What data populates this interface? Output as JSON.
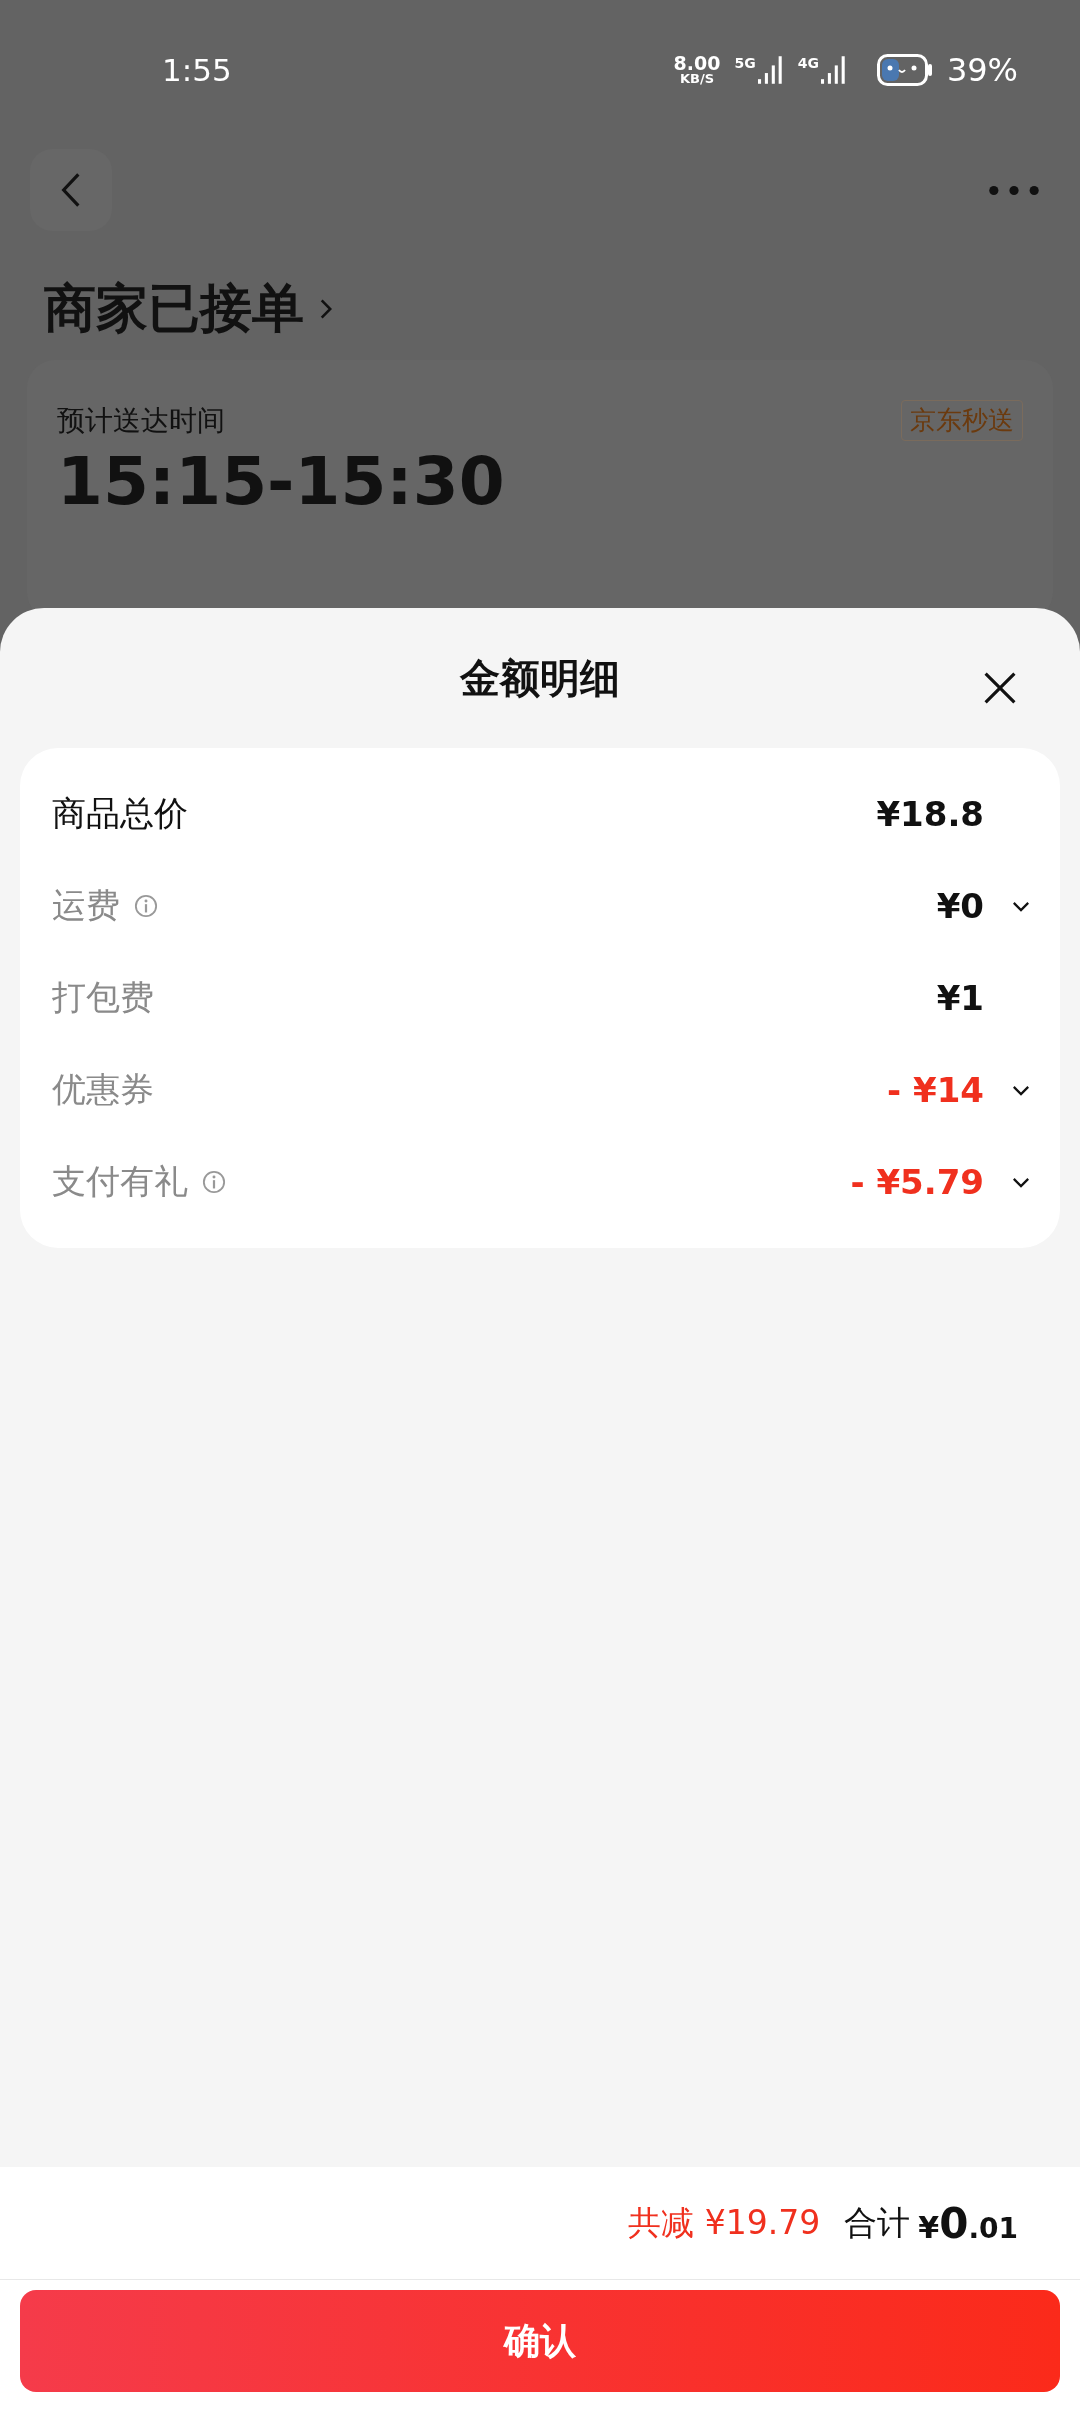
{
  "status_bar": {
    "time": "1:55",
    "net_speed": "8.00",
    "net_unit": "KB/S",
    "signals": [
      {
        "label": "5G"
      },
      {
        "label": "4G"
      }
    ],
    "battery": "39%"
  },
  "page": {
    "title": "商家已接单",
    "delivery_label": "预计送达时间",
    "delivery_time": "15:15-15:30",
    "service_tag": "京东秒送"
  },
  "sheet": {
    "title": "金额明细",
    "rows": [
      {
        "label": "商品总价",
        "primary": true,
        "info": false,
        "value": "¥18.8",
        "discount": false,
        "expandable": false
      },
      {
        "label": "运费",
        "primary": false,
        "info": true,
        "value": "¥0",
        "discount": false,
        "expandable": true
      },
      {
        "label": "打包费",
        "primary": false,
        "info": false,
        "value": "¥1",
        "discount": false,
        "expandable": false
      },
      {
        "label": "优惠券",
        "primary": false,
        "info": false,
        "value": "- ¥14",
        "discount": true,
        "expandable": true
      },
      {
        "label": "支付有礼",
        "primary": false,
        "info": true,
        "value": "- ¥5.79",
        "discount": true,
        "expandable": true
      }
    ],
    "savings": "共减 ¥19.79",
    "total_label": "合计",
    "total_currency": "¥",
    "total_integer": "0",
    "total_decimal": ".01",
    "confirm": "确认"
  }
}
